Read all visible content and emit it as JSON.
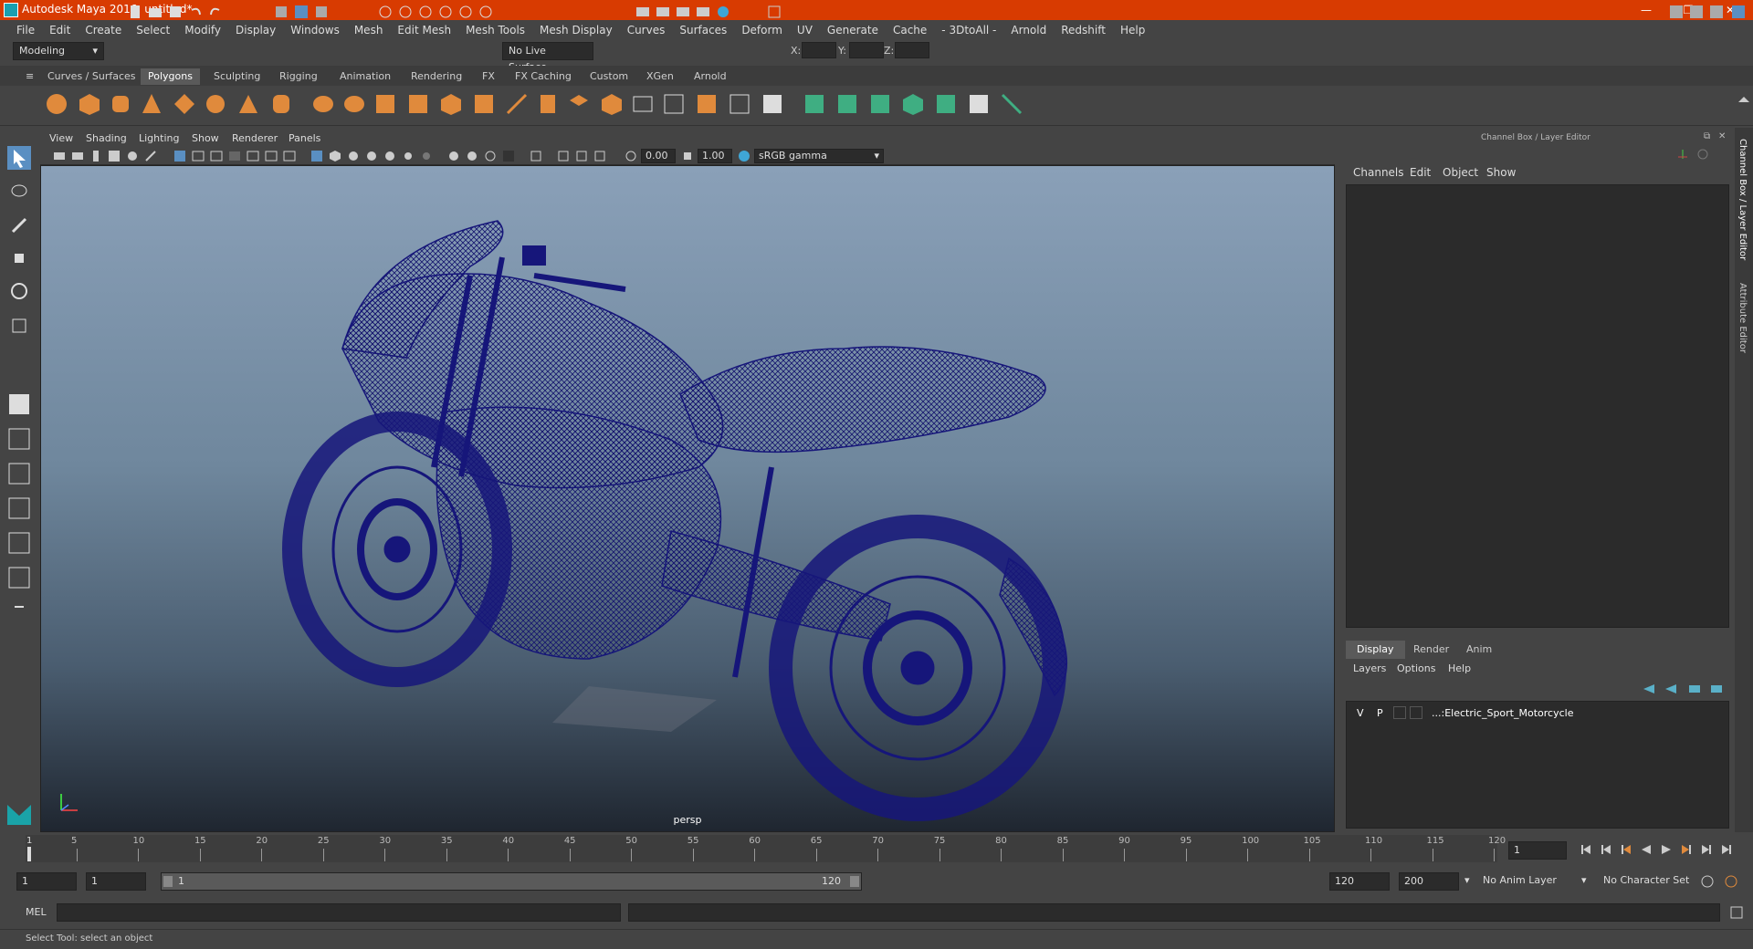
{
  "window": {
    "title": "Autodesk Maya 2016: untitled*",
    "minimize": "—",
    "maximize": "❐",
    "close": "✕"
  },
  "menubar": [
    "File",
    "Edit",
    "Create",
    "Select",
    "Modify",
    "Display",
    "Windows",
    "Mesh",
    "Edit Mesh",
    "Mesh Tools",
    "Mesh Display",
    "Curves",
    "Surfaces",
    "Deform",
    "UV",
    "Generate",
    "Cache",
    "- 3DtoAll -",
    "Arnold",
    "Redshift",
    "Help"
  ],
  "statusline": {
    "mode": "Modeling",
    "live_surface": "No Live Surface",
    "x_label": "X:",
    "y_label": "Y:",
    "z_label": "Z:"
  },
  "shelf": {
    "tabs": [
      "Curves / Surfaces",
      "Polygons",
      "Sculpting",
      "Rigging",
      "Animation",
      "Rendering",
      "FX",
      "FX Caching",
      "Custom",
      "XGen",
      "Arnold"
    ],
    "active_tab": "Polygons"
  },
  "viewport": {
    "menu": [
      "View",
      "Shading",
      "Lighting",
      "Show",
      "Renderer",
      "Panels"
    ],
    "exposure": "0.00",
    "gamma": "1.00",
    "color_space": "sRGB gamma",
    "camera_label": "persp",
    "accent": "#1a1a7a"
  },
  "channel_box": {
    "header": "Channel Box / Layer Editor",
    "menu": [
      "Channels",
      "Edit",
      "Object",
      "Show"
    ]
  },
  "layer_editor": {
    "tabs": [
      "Display",
      "Render",
      "Anim"
    ],
    "active_tab": "Display",
    "menu": [
      "Layers",
      "Options",
      "Help"
    ],
    "layer": {
      "visible": "V",
      "playback": "P",
      "name": "...:Electric_Sport_Motorcycle"
    }
  },
  "side_tabs": [
    "Channel Box / Layer Editor",
    "Attribute Editor"
  ],
  "timeline": {
    "ticks": [
      "5",
      "10",
      "15",
      "20",
      "25",
      "30",
      "35",
      "40",
      "45",
      "50",
      "55",
      "60",
      "65",
      "70",
      "75",
      "80",
      "85",
      "90",
      "95",
      "100",
      "105",
      "110",
      "115",
      "120"
    ],
    "start_marker": "1",
    "current_frame": "1"
  },
  "range": {
    "start": "1",
    "playback_start": "1",
    "slider_start": "1",
    "slider_end": "120",
    "playback_end": "120",
    "end": "200",
    "anim_layer": "No Anim Layer",
    "character_set": "No Character Set"
  },
  "command_line": {
    "label": "MEL"
  },
  "help_line": "Select Tool: select an object"
}
